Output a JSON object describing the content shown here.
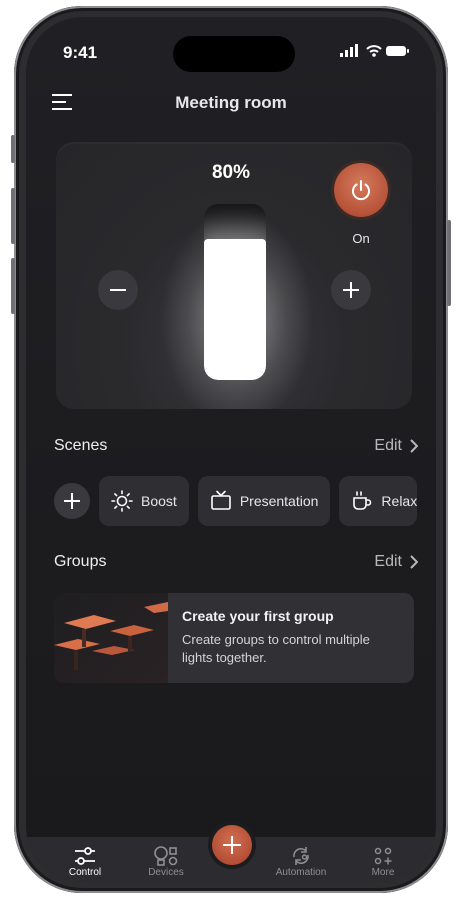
{
  "status": {
    "time": "9:41"
  },
  "header": {
    "title": "Meeting room"
  },
  "light": {
    "brightness_label": "80%",
    "brightness": 0.8,
    "power_label": "On"
  },
  "scenes": {
    "title": "Scenes",
    "edit_label": "Edit",
    "items": [
      {
        "label": "Boost",
        "icon": "sun-icon"
      },
      {
        "label": "Presentation",
        "icon": "tv-icon"
      },
      {
        "label": "Relax",
        "icon": "cup-icon"
      }
    ]
  },
  "groups": {
    "title": "Groups",
    "edit_label": "Edit",
    "card_title": "Create your first group",
    "card_desc": "Create groups to control multiple lights together."
  },
  "tabs": [
    {
      "label": "Control",
      "icon": "sliders-icon",
      "active": true
    },
    {
      "label": "Devices",
      "icon": "bulb-icon",
      "active": false
    },
    {
      "label": "Automation",
      "icon": "cycle-icon",
      "active": false
    },
    {
      "label": "More",
      "icon": "dots-icon",
      "active": false
    }
  ],
  "colors": {
    "accent": "#b65238",
    "background": "#1c1c1f",
    "card": "#2a2a2d"
  }
}
